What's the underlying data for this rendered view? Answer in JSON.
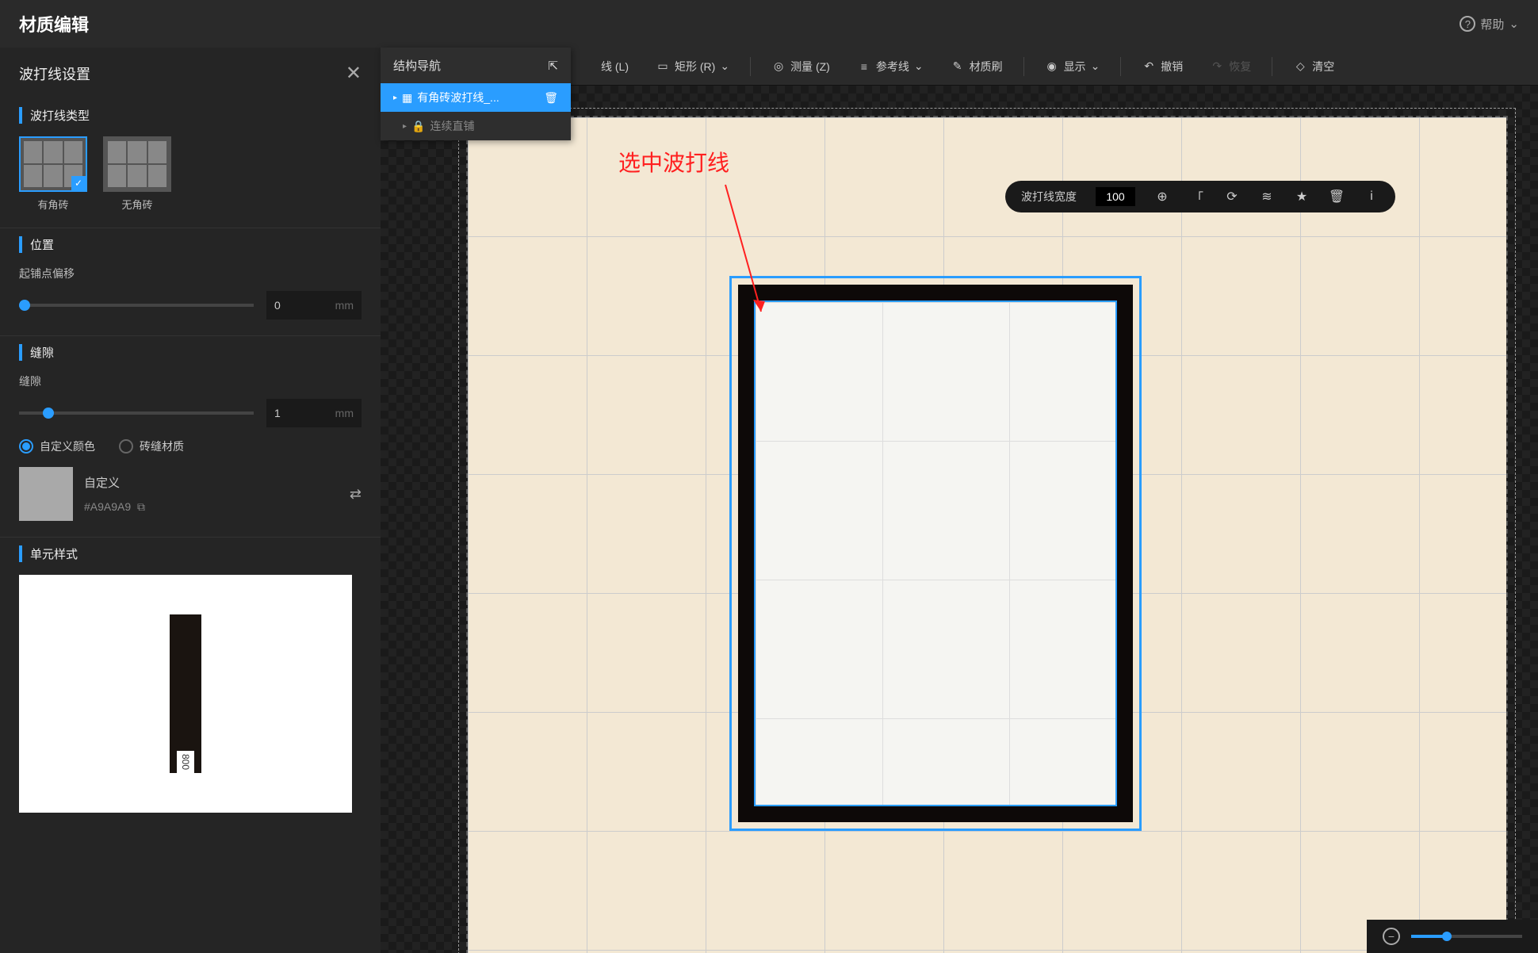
{
  "header": {
    "title": "材质编辑",
    "help": "帮助"
  },
  "sidebar": {
    "panel_title": "波打线设置",
    "type": {
      "title": "波打线类型",
      "options": [
        "有角砖",
        "无角砖"
      ],
      "selected": 0
    },
    "position": {
      "title": "位置",
      "offset_label": "起铺点偏移",
      "offset_value": "0",
      "offset_unit": "mm"
    },
    "gap": {
      "title": "缝隙",
      "gap_label": "缝隙",
      "gap_value": "1",
      "gap_unit": "mm",
      "radio_custom": "自定义颜色",
      "radio_material": "砖缝材质",
      "custom_name": "自定义",
      "custom_hex": "#A9A9A9"
    },
    "unit": {
      "title": "单元样式",
      "preview_num": "800"
    }
  },
  "struct_nav": {
    "title": "结构导航",
    "items": [
      {
        "label": "有角砖波打线_...",
        "active": true
      },
      {
        "label": "连续直铺",
        "locked": true
      }
    ]
  },
  "toolbar": {
    "line": "线 (L)",
    "rect": "矩形 (R)",
    "measure": "测量 (Z)",
    "guide": "参考线",
    "brush": "材质刷",
    "display": "显示",
    "undo": "撤销",
    "redo": "恢复",
    "clear": "清空"
  },
  "ctx": {
    "width_label": "波打线宽度",
    "width_value": "100"
  },
  "annotation": "选中波打线",
  "colors": {
    "accent": "#2a9dff",
    "annotation": "#ff2020",
    "swatch": "#A9A9A9"
  }
}
